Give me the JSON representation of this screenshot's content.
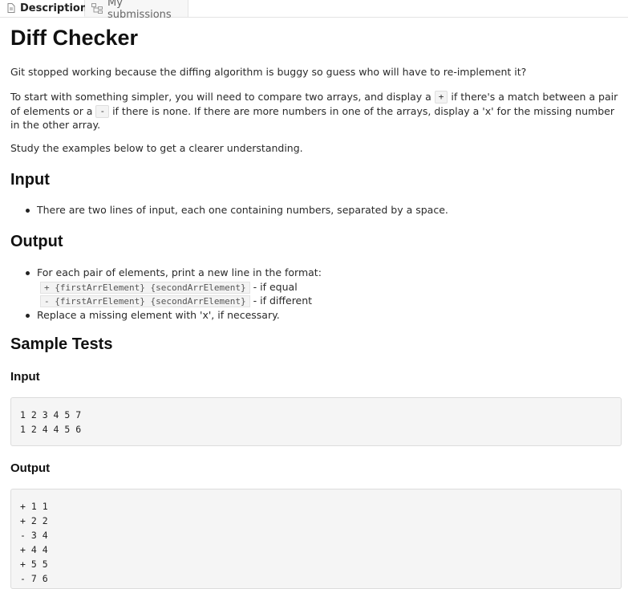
{
  "tabs": [
    {
      "label": "Description",
      "icon": "document-icon",
      "active": true
    },
    {
      "label": "My submissions",
      "icon": "tree-icon",
      "active": false
    }
  ],
  "title": "Diff Checker",
  "intro": "Git stopped working because the diffing algorithm is buggy so guess who will have to re-implement it?",
  "task": {
    "part1": "To start with something simpler, you will need to compare two arrays, and display a",
    "plus": "+",
    "part2": "if there's a match between a pair of elements or a",
    "minus": "-",
    "part3": "if there is none. If there are more numbers in one of the arrays, display a 'x' for the missing number in the other array."
  },
  "study": "Study the examples below to get a clearer understanding.",
  "input_section": {
    "heading": "Input",
    "items": [
      "There are two lines of input, each one containing numbers, separated by a space."
    ]
  },
  "output_section": {
    "heading": "Output",
    "item1": "For each pair of elements, print a new line in the format:",
    "format_equal": "+ {firstArrElement} {secondArrElement}",
    "format_equal_note": "- if equal",
    "format_diff": "- {firstArrElement} {secondArrElement}",
    "format_diff_note": "- if different",
    "item2": "Replace a missing element with 'x', if necessary."
  },
  "sample_tests": {
    "heading": "Sample Tests",
    "input_heading": "Input",
    "input_lines": [
      "1 2 3 4 5 7",
      "1 2 4 4 5 6"
    ],
    "output_heading": "Output",
    "output_lines": [
      "+ 1 1",
      "+ 2 2",
      "- 3 4",
      "+ 4 4",
      "+ 5 5",
      "- 7 6"
    ]
  }
}
